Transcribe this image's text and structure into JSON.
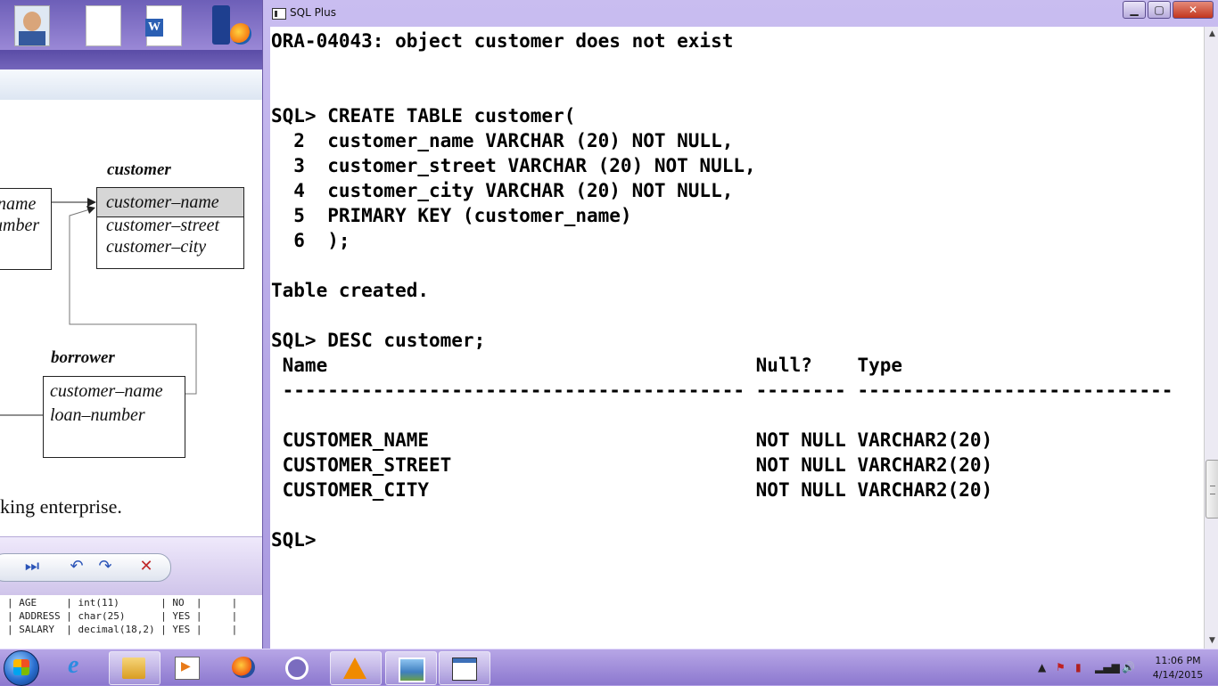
{
  "window": {
    "title": "SQL Plus"
  },
  "console_lines": [
    "ORA-04043: object customer does not exist",
    "",
    "",
    "SQL> CREATE TABLE customer(",
    "  2  customer_name VARCHAR (20) NOT NULL,",
    "  3  customer_street VARCHAR (20) NOT NULL,",
    "  4  customer_city VARCHAR (20) NOT NULL,",
    "  5  PRIMARY KEY (customer_name)",
    "  6  );",
    "",
    "Table created.",
    "",
    "SQL> DESC customer;",
    " Name                                      Null?    Type",
    " ----------------------------------------- -------- ----------------------------",
    "",
    " CUSTOMER_NAME                             NOT NULL VARCHAR2(20)",
    " CUSTOMER_STREET                           NOT NULL VARCHAR2(20)",
    " CUSTOMER_CITY                             NOT NULL VARCHAR2(20)",
    "",
    "SQL>"
  ],
  "background_document": {
    "er": {
      "customer_title": "customer",
      "customer_attrs": [
        "customer–name",
        "customer–street",
        "customer–city"
      ],
      "borrower_title": "borrower",
      "borrower_attrs": [
        "customer–name",
        "loan–number"
      ],
      "left_partial": [
        "name",
        "umber"
      ]
    },
    "caption": "king enterprise."
  },
  "background_terminal": {
    "rows": [
      "| AGE     | int(11)       | NO  |     |",
      "| ADDRESS | char(25)      | YES |     |",
      "| SALARY  | decimal(18,2) | YES |     |"
    ]
  },
  "player": {
    "icons": [
      "next-icon",
      "undo-icon",
      "redo-icon",
      "close-icon"
    ]
  },
  "taskbar": {
    "items": [
      "internet-explorer",
      "windows-explorer",
      "media-player",
      "firefox",
      "vuze",
      "vlc",
      "photo-viewer",
      "sql-plus"
    ],
    "active": "sql-plus"
  },
  "clock": {
    "time": "11:06 PM",
    "date": "4/14/2015"
  }
}
